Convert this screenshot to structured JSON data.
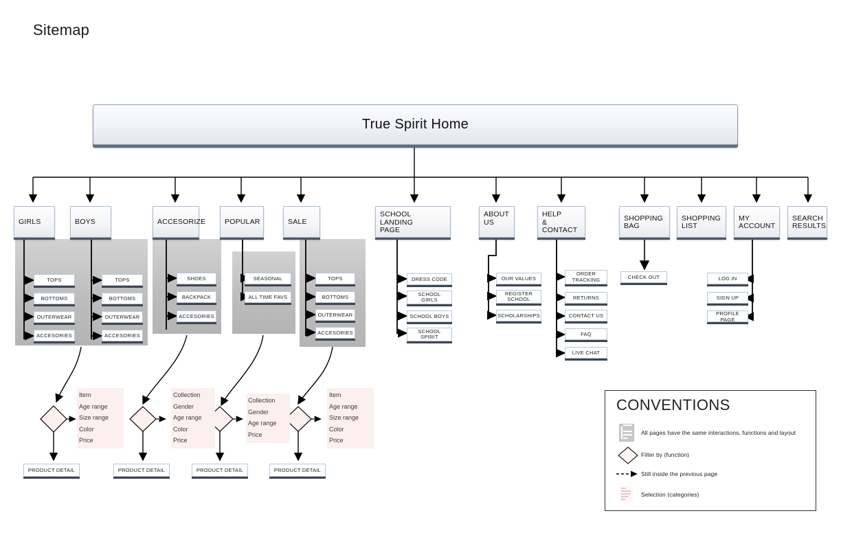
{
  "page": {
    "title": "Sitemap",
    "root": {
      "label": "True Spirit Home"
    }
  },
  "top_level": [
    {
      "name": "girls",
      "lines": [
        "GIRLS"
      ]
    },
    {
      "name": "boys",
      "lines": [
        "BOYS"
      ]
    },
    {
      "name": "accesorize",
      "lines": [
        "ACCESORIZE"
      ]
    },
    {
      "name": "popular",
      "lines": [
        "POPULAR"
      ]
    },
    {
      "name": "sale",
      "lines": [
        "SALE"
      ]
    },
    {
      "name": "school-landing",
      "lines": [
        "SCHOOL",
        "LANDING",
        "PAGE"
      ]
    },
    {
      "name": "about-us",
      "lines": [
        "ABOUT",
        "US"
      ]
    },
    {
      "name": "help-contact",
      "lines": [
        "HELP",
        "&",
        "CONTACT"
      ]
    },
    {
      "name": "shopping-bag",
      "lines": [
        "SHOPPING",
        "BAG"
      ]
    },
    {
      "name": "shopping-list",
      "lines": [
        "SHOPPING",
        "LIST"
      ]
    },
    {
      "name": "my-account",
      "lines": [
        "MY",
        "ACCOUNT"
      ]
    },
    {
      "name": "search-results",
      "lines": [
        "SEARCH",
        "RESULTS"
      ]
    }
  ],
  "children": {
    "girls": [
      "TOPS",
      "BOTTOMS",
      "OUTERWEAR",
      "ACCESORIES"
    ],
    "boys": [
      "TOPS",
      "BOTTOMS",
      "OUTERWEAR",
      "ACCESORIES"
    ],
    "accesorize": [
      "SHOES",
      "BACKPACK",
      "ACCESORIES"
    ],
    "popular": [
      "SEASONAL",
      "ALL TIME FAVS"
    ],
    "sale": [
      "TOPS",
      "BOTTOMS",
      "OUTERWEAR",
      "ACCESORIES"
    ],
    "school": [
      "DRESS CODE",
      "SCHOOL\nGIRLS",
      "SCHOOL BOYS",
      "SCHOOL\nSPIRIT"
    ],
    "about": [
      "OUR VALUES",
      "REGISTER\nSCHOOL",
      "SCHOLARSHIPS"
    ],
    "help": [
      "ORDER\nTRACKING",
      "RETURNS",
      "CONTACT US",
      "FAQ",
      "LIVE CHAT"
    ],
    "bag": [
      "CHECK OUT"
    ],
    "account": [
      "LOG IN",
      "SIGN UP",
      "PROFILE PAGE"
    ]
  },
  "filters": [
    {
      "name": "girls-boys-filter",
      "items": [
        "Item",
        "Age range",
        "Size range",
        "Color",
        "Price"
      ]
    },
    {
      "name": "accesorize-filter",
      "items": [
        "Collection",
        "Gender",
        "Age range",
        "Color",
        "Price"
      ]
    },
    {
      "name": "popular-filter",
      "items": [
        "Collection",
        "Gender",
        "Age range",
        "Price"
      ]
    },
    {
      "name": "sale-filter",
      "items": [
        "Item",
        "Age range",
        "Size range",
        "Color",
        "Price"
      ]
    }
  ],
  "product_detail_label": "PRODUCT DETAIL",
  "conventions": {
    "title": "CONVENTIONS",
    "rows": [
      {
        "icon": "page-layout-icon",
        "text": "All pages have the same interactions, functions and layout"
      },
      {
        "icon": "diamond-icon",
        "text": "Filter by (function)"
      },
      {
        "icon": "dashed-arrow-icon",
        "text": "Still inside the previous page"
      },
      {
        "icon": "selection-list-icon",
        "text": "Selection (categories)"
      }
    ]
  },
  "colors": {
    "panel_gray": "#bdbdbd",
    "filter_pink": "#fbf0ee",
    "box_border": "#b6c7dc",
    "shadow": "#3f4653"
  }
}
